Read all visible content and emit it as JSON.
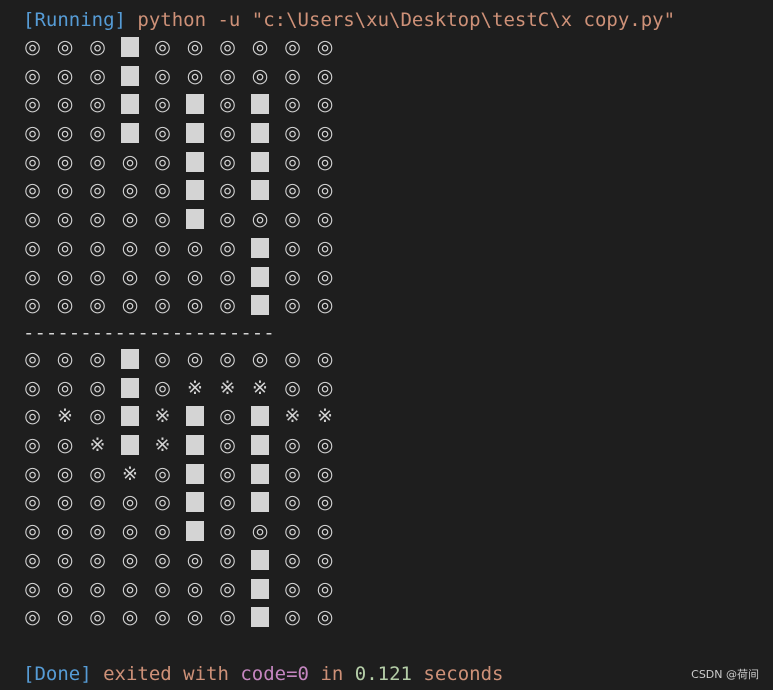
{
  "header": {
    "running_tag": "[Running]",
    "command": " python -u \"c:\\Users\\xu\\Desktop\\testC\\x copy.py\""
  },
  "symbols": {
    "circle": "◎",
    "star": "※",
    "block": "█"
  },
  "grid_top": [
    "◎◎◎█◎◎◎◎◎◎",
    "◎◎◎█◎◎◎◎◎◎",
    "◎◎◎█◎█◎█◎◎",
    "◎◎◎█◎█◎█◎◎",
    "◎◎◎◎◎█◎█◎◎",
    "◎◎◎◎◎█◎█◎◎",
    "◎◎◎◎◎█◎◎◎◎",
    "◎◎◎◎◎◎◎█◎◎",
    "◎◎◎◎◎◎◎█◎◎",
    "◎◎◎◎◎◎◎█◎◎"
  ],
  "separator": "----------------------",
  "grid_bottom": [
    "◎◎◎█◎◎◎◎◎◎",
    "◎◎◎█◎※※※◎◎",
    "◎※◎█※█◎█※※",
    "◎◎※█※█◎█◎◎",
    "◎◎◎※◎█◎█◎◎",
    "◎◎◎◎◎█◎█◎◎",
    "◎◎◎◎◎█◎◎◎◎",
    "◎◎◎◎◎◎◎█◎◎",
    "◎◎◎◎◎◎◎█◎◎",
    "◎◎◎◎◎◎◎█◎◎"
  ],
  "footer": {
    "done_tag": "[Done]",
    "exited_with": " exited with ",
    "code_label": "code=0",
    "in_label": " in ",
    "time": "0.121",
    "seconds": " seconds"
  },
  "watermark": "CSDN @荷间"
}
